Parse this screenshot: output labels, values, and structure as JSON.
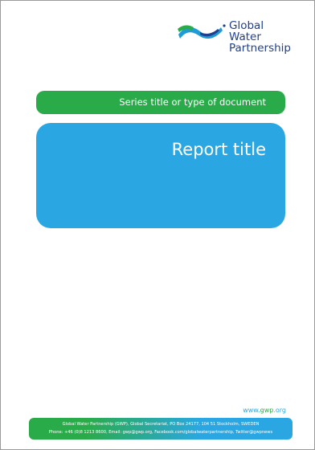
{
  "logo": {
    "icon": "gwp-water-wave-icon",
    "line1": "Global Water",
    "line2": "Partnership"
  },
  "series_label": "Series title or type of document",
  "report_title": "Report title",
  "website": {
    "prefix": "www.",
    "domain": "gwp",
    "suffix": ".org"
  },
  "footer": {
    "line1": "Global Water Partnership (GWP), Global Secretariat, PO Box 24177, 104 51 Stockholm, SWEDEN",
    "line2": "Phone: +46 (0)8 1213 8600, Email: gwp@gwp.org, Facebook.com/globalwaterpartnership, Twitter@gwpnews"
  },
  "colors": {
    "green": "#2aab4a",
    "blue": "#2aa7e2",
    "navy": "#1f3f8f"
  }
}
